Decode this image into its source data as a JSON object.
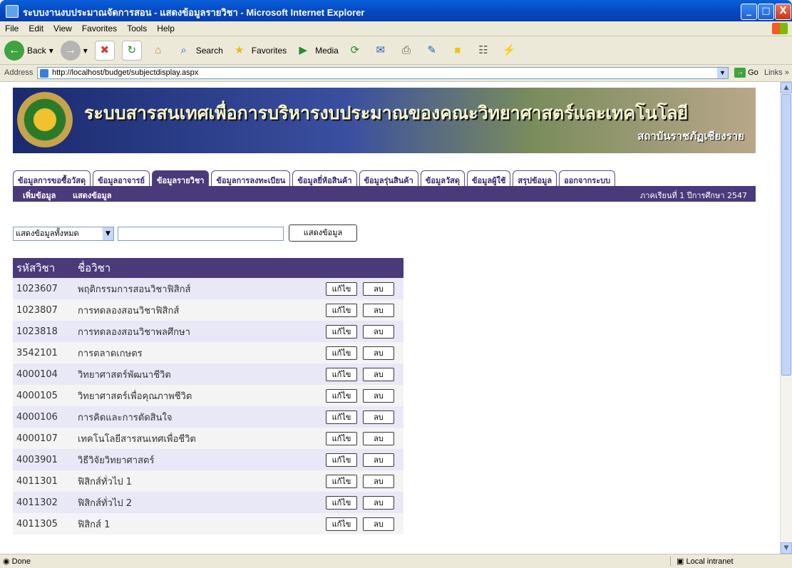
{
  "window": {
    "title": "ระบบงานงบประมาณจัดการสอน - แสดงข้อมูลรายวิชา - Microsoft Internet Explorer",
    "min": "_",
    "max": "□",
    "close": "X"
  },
  "menu": [
    "File",
    "Edit",
    "View",
    "Favorites",
    "Tools",
    "Help"
  ],
  "toolbar": {
    "back": "Back",
    "search": "Search",
    "favorites": "Favorites",
    "media": "Media"
  },
  "address": {
    "label": "Address",
    "url": "http://localhost/budget/subjectdisplay.aspx",
    "go": "Go",
    "links": "Links"
  },
  "banner": {
    "headline": "ระบบสารสนเทศเพื่อการบริหารงบประมาณของคณะวิทยาศาสตร์และเทคโนโลยี",
    "sub": "สถาบันราชภัฏเชียงราย"
  },
  "tabs": [
    {
      "label": "ข้อมูลการขอซื้อวัสดุ"
    },
    {
      "label": "ข้อมูลอาจารย์"
    },
    {
      "label": "ข้อมูลรายวิชา"
    },
    {
      "label": "ข้อมูลการลงทะเบียน"
    },
    {
      "label": "ข้อมูลยี่ห้อสินค้า"
    },
    {
      "label": "ข้อมูลรุ่นสินค้า"
    },
    {
      "label": "ข้อมูลวัสดุ"
    },
    {
      "label": "ข้อมูลผู้ใช้"
    },
    {
      "label": "สรุปข้อมูล"
    },
    {
      "label": "ออกจากระบบ"
    }
  ],
  "subnav": {
    "add": "เพิ่มข้อมูล",
    "show": "แสดงข้อมูล",
    "term": "ภาคเรียนที่ 1 ปีการศึกษา 2547"
  },
  "filter": {
    "selected": "แสดงข้อมูลทั้งหมด",
    "search_value": "",
    "button": "แสดงข้อมูล"
  },
  "table": {
    "headers": {
      "code": "รหัสวิชา",
      "name": "ชื่อวิชา"
    },
    "edit_label": "แก้ไข",
    "delete_label": "ลบ",
    "rows": [
      {
        "code": "1023607",
        "name": "พฤติกรรมการสอนวิชาฟิสิกส์"
      },
      {
        "code": "1023807",
        "name": "การทดลองสอนวิชาฟิสิกส์"
      },
      {
        "code": "1023818",
        "name": "การทดลองสอนวิชาพลศึกษา"
      },
      {
        "code": "3542101",
        "name": "การตลาดเกษตร"
      },
      {
        "code": "4000104",
        "name": "วิทยาศาสตร์พัฒนาชีวิต"
      },
      {
        "code": "4000105",
        "name": "วิทยาศาสตร์เพื่อคุณภาพชีวิต"
      },
      {
        "code": "4000106",
        "name": "การคิดและการตัดสินใจ"
      },
      {
        "code": "4000107",
        "name": "เทคโนโลยีสารสนเทศเพื่อชีวิต"
      },
      {
        "code": "4003901",
        "name": "วิธีวิจัยวิทยาศาสตร์"
      },
      {
        "code": "4011301",
        "name": "ฟิสิกส์ทั่วไป 1"
      },
      {
        "code": "4011302",
        "name": "ฟิสิกส์ทั่วไป 2"
      },
      {
        "code": "4011305",
        "name": "ฟิสิกส์ 1"
      }
    ]
  },
  "status": {
    "done": "Done",
    "zone": "Local intranet"
  }
}
